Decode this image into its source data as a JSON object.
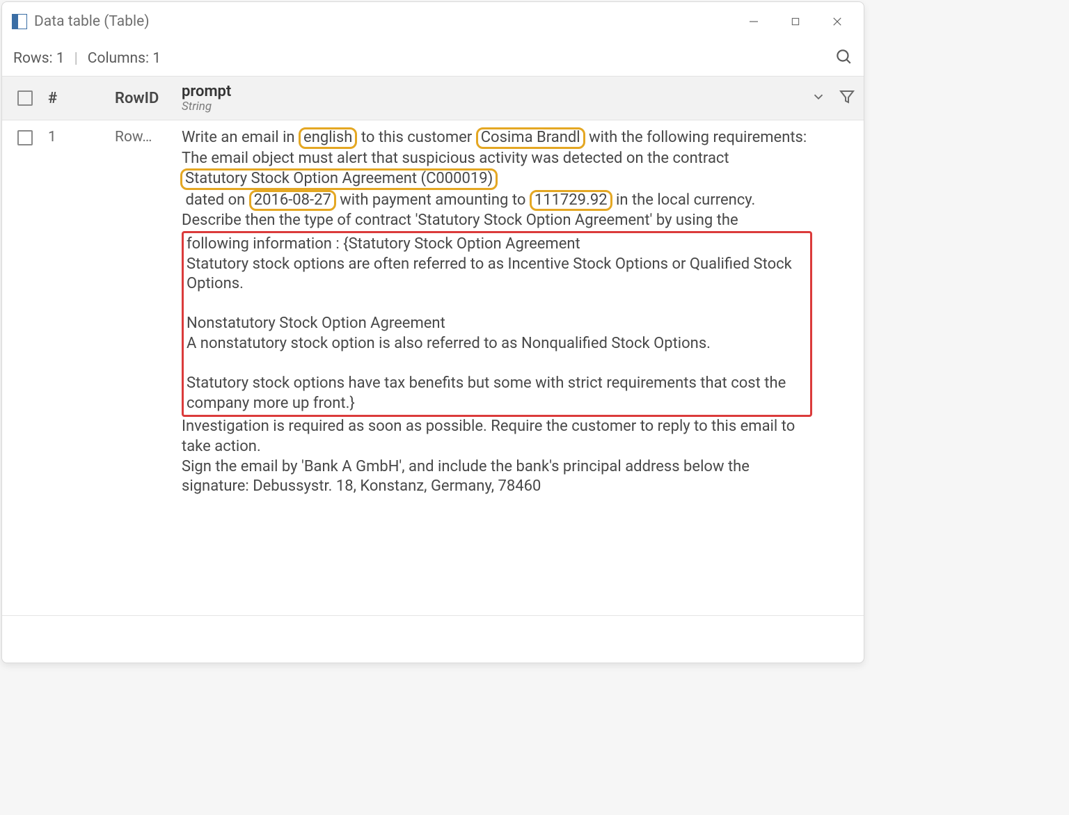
{
  "window": {
    "title": "Data table (Table)"
  },
  "infobar": {
    "rows_label": "Rows:",
    "rows_value": "1",
    "cols_label": "Columns:",
    "cols_value": "1"
  },
  "header": {
    "num": "#",
    "rowid": "RowID",
    "col_name": "prompt",
    "col_type": "String"
  },
  "row": {
    "num": "1",
    "rowid": "Row…",
    "cell": {
      "l1a": "Write an email in ",
      "hl_lang": "english",
      "l1b": " to this customer ",
      "hl_customer": "Cosima Brandl",
      "l1c": " with the following requirements:",
      "l2": "The email object must alert that suspicious activity was detected on the contract ",
      "hl_contract": "Statutory Stock Option Agreement (C000019)",
      "l3a": " dated on ",
      "hl_date": "2016-08-27",
      "l3b": " with payment amounting to ",
      "hl_amount": "111729.92",
      "l3c": " in the local currency.",
      "l4": "Describe then the type of contract 'Statutory Stock Option Agreement' by using the ",
      "red1": "following information : {Statutory Stock Option Agreement",
      "red2": "Statutory stock options are often referred to as Incentive Stock Options or Qualified Stock Options.",
      "red3": "",
      "red4": "Nonstatutory Stock Option Agreement",
      "red5": "A nonstatutory stock option is also referred to as Nonqualified Stock Options.",
      "red6": "",
      "red7": "Statutory stock options have tax benefits but some with strict requirements that cost the company more up front.}",
      "l5": "Investigation is required as soon as possible. Require the customer to reply to this email to take action.",
      "l6": "Sign the email by 'Bank A GmbH', and include the bank's principal address below the signature: Debussystr. 18, Konstanz, Germany, 78460"
    }
  }
}
